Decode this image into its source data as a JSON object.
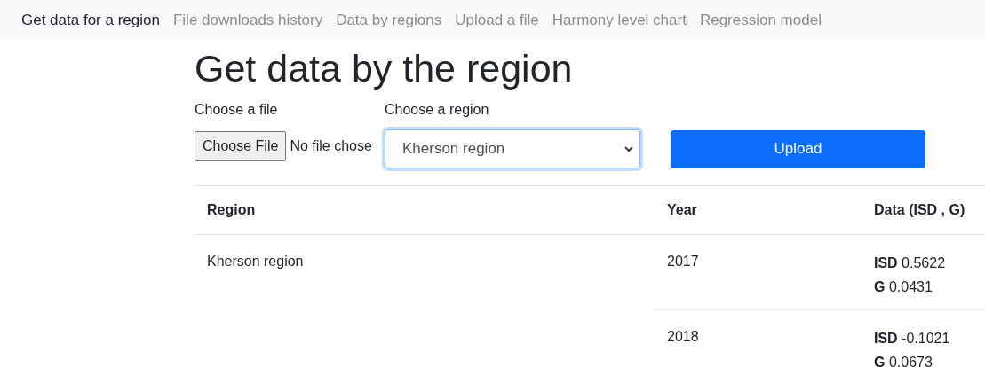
{
  "nav": {
    "items": [
      {
        "label": "Get data for a region",
        "selected": true
      },
      {
        "label": "File downloads history",
        "selected": false
      },
      {
        "label": "Data by regions",
        "selected": false
      },
      {
        "label": "Upload a file",
        "selected": false
      },
      {
        "label": "Harmony level chart",
        "selected": false
      },
      {
        "label": "Regression model",
        "selected": false
      }
    ]
  },
  "title": "Get data by the region",
  "form": {
    "file_label": "Choose a file",
    "file_button": "Choose File",
    "file_status": "No file chose",
    "region_label": "Choose a region",
    "region_value": "Kherson region",
    "upload_button": "Upload"
  },
  "table": {
    "columns": [
      "Region",
      "Year",
      "Data (ISD , G)"
    ],
    "groups": [
      {
        "region": "Kherson region",
        "rows": [
          {
            "year": "2017",
            "lines": [
              "**ISD** 0.5622",
              "**G** 0.0431"
            ]
          },
          {
            "year": "2018",
            "lines": [
              "**ISD** -0.1021",
              "**G** 0.0673"
            ]
          }
        ]
      }
    ]
  }
}
